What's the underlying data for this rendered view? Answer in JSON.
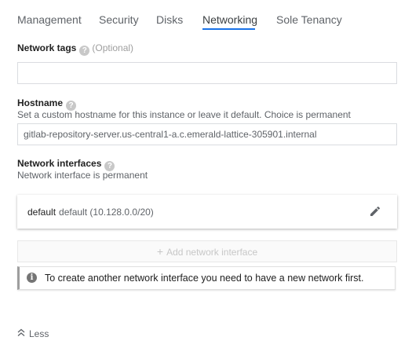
{
  "tabs": [
    {
      "label": "Management"
    },
    {
      "label": "Security"
    },
    {
      "label": "Disks"
    },
    {
      "label": "Networking"
    },
    {
      "label": "Sole Tenancy"
    }
  ],
  "active_tab": "Networking",
  "network_tags": {
    "label": "Network tags",
    "optional": "(Optional)",
    "value": ""
  },
  "hostname": {
    "label": "Hostname",
    "hint": "Set a custom hostname for this instance or leave it default. Choice is permanent",
    "value": "gitlab-repository-server.us-central1-a.c.emerald-lattice-305901.internal"
  },
  "network_interfaces": {
    "label": "Network interfaces",
    "hint": "Network interface is permanent",
    "items": [
      {
        "name": "default",
        "detail": "default (10.128.0.0/20)"
      }
    ],
    "add_label": "Add network interface",
    "info": "To create another network interface you need to have a new network first."
  },
  "less_label": "Less",
  "colors": {
    "accent": "#1a73e8",
    "text": "#212121",
    "muted": "#5f6368"
  }
}
